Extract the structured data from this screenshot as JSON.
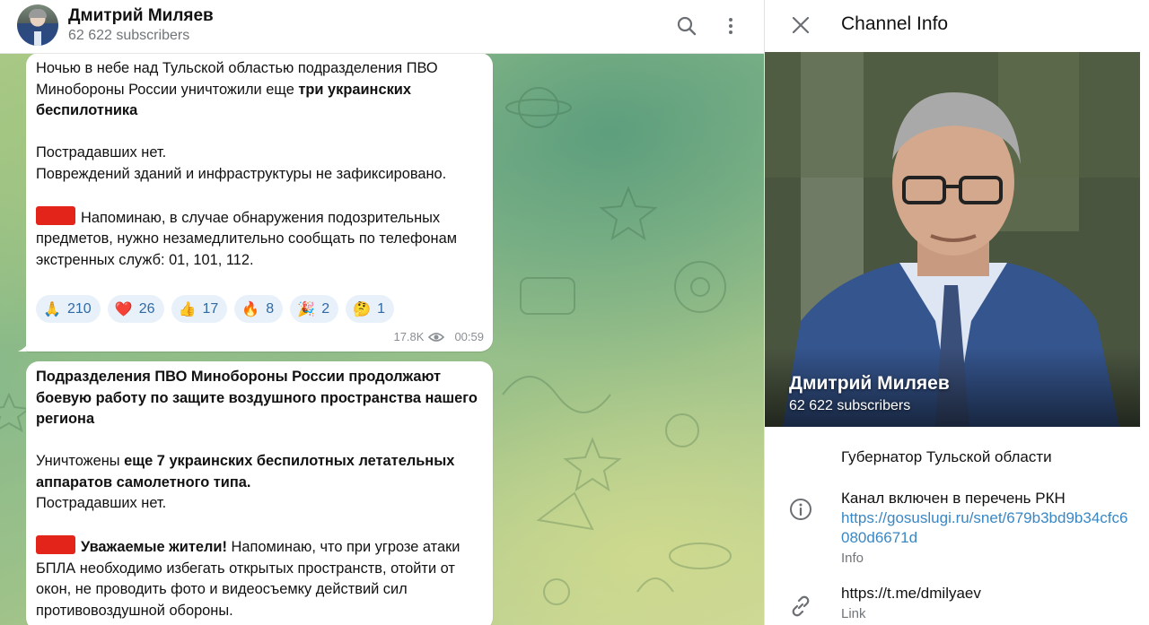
{
  "chat": {
    "title": "Дмитрий Миляев",
    "subtitle": "62 622 subscribers",
    "icons": {
      "search": "search-icon",
      "more": "more-vertical-icon"
    }
  },
  "messages": [
    {
      "lines": {
        "p1_a": "Ночью в небе над Тульской областью подразделения ПВО Минобороны России уничтожили еще ",
        "p1_b": "три украинских беспилотника",
        "p2": "Пострадавших нет.",
        "p3": "Повреждений зданий и инфраструктуры не зафиксировано.",
        "p4": "Напоминаю, в случае обнаружения подозрительных предметов, нужно незамедлительно сообщать по телефонам экстренных служб: 01, 101, 112."
      },
      "reactions": [
        {
          "emoji": "🙏",
          "count": "210"
        },
        {
          "emoji": "❤️",
          "count": "26"
        },
        {
          "emoji": "👍",
          "count": "17"
        },
        {
          "emoji": "🔥",
          "count": "8"
        },
        {
          "emoji": "🎉",
          "count": "2"
        },
        {
          "emoji": "🤔",
          "count": "1"
        }
      ],
      "views": "17.8K",
      "time": "00:59"
    },
    {
      "lines": {
        "p1": "Подразделения ПВО Минобороны России продолжают боевую работу по защите воздушного пространства нашего региона",
        "p2_a": "Уничтожены ",
        "p2_b": "еще 7 украинских беспилотных летательных аппаратов самолетного типа.",
        "p3": "Пострадавших нет.",
        "p4_a": "Уважаемые жители!",
        "p4_b": " Напоминаю, что при угрозе атаки БПЛА необходимо избегать открытых пространств, отойти от окон, не проводить фото и видеосъемку действий сил противовоздушной обороны."
      }
    }
  ],
  "info": {
    "title": "Channel Info",
    "name": "Дмитрий Миляев",
    "subscribers": "62 622 subscribers",
    "description": "Губернатор Тульской области",
    "rkn_text": "Канал включен в перечень РКН",
    "rkn_link": "https://gosuslugi.ru/snet/679b3bd9b34cfc6080d6671d",
    "rkn_label": "Info",
    "link": "https://t.me/dmilyaev",
    "link_label": "Link"
  },
  "colors": {
    "accent": "#3a87c4",
    "reaction_bg": "#e8f1fa",
    "reaction_text": "#2f6aa5",
    "red_marker": "#e3241b",
    "muted": "#707579"
  }
}
